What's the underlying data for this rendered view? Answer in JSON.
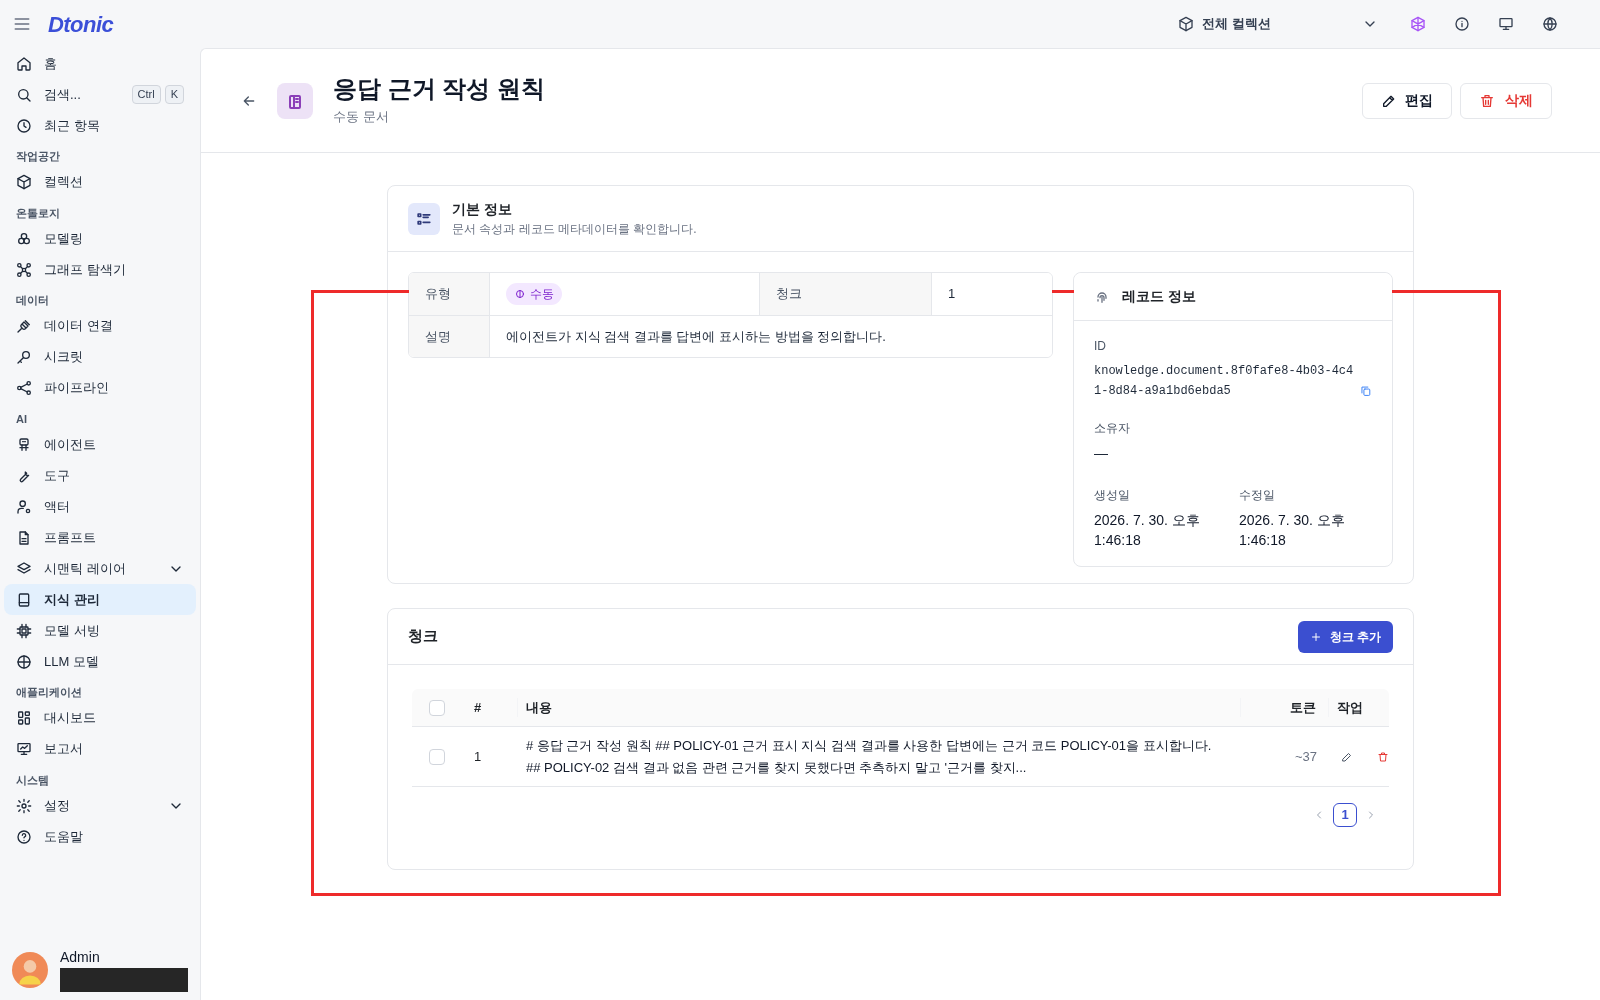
{
  "brand": "Dtonic",
  "sidebar": {
    "groups": [
      {
        "items": [
          {
            "label": "홈",
            "selected": false
          },
          {
            "label": "검색...",
            "selected": false,
            "shortcut": [
              "Ctrl",
              "K"
            ]
          },
          {
            "label": "최근 항목",
            "selected": false
          }
        ]
      },
      {
        "heading": "작업공간",
        "items": [
          {
            "label": "컬렉션",
            "selected": false
          }
        ]
      },
      {
        "heading": "온톨로지",
        "items": [
          {
            "label": "모델링",
            "selected": false
          },
          {
            "label": "그래프 탐색기",
            "selected": false
          }
        ]
      },
      {
        "heading": "데이터",
        "items": [
          {
            "label": "데이터 연결",
            "selected": false
          },
          {
            "label": "시크릿",
            "selected": false
          },
          {
            "label": "파이프라인",
            "selected": false
          }
        ]
      },
      {
        "heading": "AI",
        "items": [
          {
            "label": "에이전트",
            "selected": false
          },
          {
            "label": "도구",
            "selected": false
          },
          {
            "label": "액터",
            "selected": false
          },
          {
            "label": "프롬프트",
            "selected": false
          },
          {
            "label": "시맨틱 레이어",
            "selected": false,
            "expanded": false
          },
          {
            "label": "지식 관리",
            "selected": true
          },
          {
            "label": "모델 서빙",
            "selected": false
          },
          {
            "label": "LLM 모델",
            "selected": false
          }
        ]
      },
      {
        "heading": "애플리케이션",
        "items": [
          {
            "label": "대시보드",
            "selected": false
          },
          {
            "label": "보고서",
            "selected": false
          }
        ]
      },
      {
        "heading": "시스템",
        "items": [
          {
            "label": "설정",
            "selected": false,
            "expanded": false
          },
          {
            "label": "도움말",
            "selected": false
          }
        ]
      }
    ]
  },
  "user": {
    "name": "Admin"
  },
  "topbar": {
    "collection": "전체 컬렉션"
  },
  "page": {
    "title": "응답 근거 작성 원칙",
    "subtitle": "수동 문서",
    "actions": [
      {
        "label": "편집",
        "kind": "edit"
      },
      {
        "label": "삭제",
        "kind": "delete"
      }
    ]
  },
  "info_card": {
    "title": "기본 정보",
    "subtitle": "문서 속성과 레코드 메타데이터를 확인합니다.",
    "rows": [
      [
        {
          "label": "유형",
          "value": "수동",
          "kind": "badge"
        },
        {
          "label": "청크",
          "value": "1",
          "kind": "text"
        }
      ],
      [
        {
          "label": "설명",
          "value": "에이전트가 지식 검색 결과를 답변에 표시하는 방법을 정의합니다.",
          "kind": "text"
        }
      ]
    ],
    "record": {
      "title": "레코드 정보",
      "id_label": "ID",
      "id": "knowledge.document.8f0fafe8-4b03-4c41-8d84-a9a1bd6ebda5",
      "owner_label": "소유자",
      "owner": "—",
      "dates": [
        {
          "label": "생성일",
          "value": "2026. 7. 30. 오후 1:46:18"
        },
        {
          "label": "수정일",
          "value": "2026. 7. 30. 오후 1:46:18"
        }
      ]
    }
  },
  "chunks": {
    "title": "청크",
    "add_button": "청크 추가",
    "select_all_checked": false,
    "columns": [
      "#",
      "내용",
      "토큰",
      "작업"
    ],
    "rows": [
      {
        "checked": false,
        "number": "1",
        "content": "# 응답 근거 작성 원칙 ## POLICY-01 근거 표시 지식 검색 결과를 사용한 답변에는 근거 코드 POLICY-01을 표시합니다. ## POLICY-02 검색 결과 없음 관련 근거를 찾지 못했다면 추측하지 말고 '근거를 찾지...",
        "tokens": "~37"
      }
    ],
    "pages": [
      {
        "label": "1",
        "selected": true
      }
    ]
  },
  "annotation": {
    "kind": "frame"
  }
}
